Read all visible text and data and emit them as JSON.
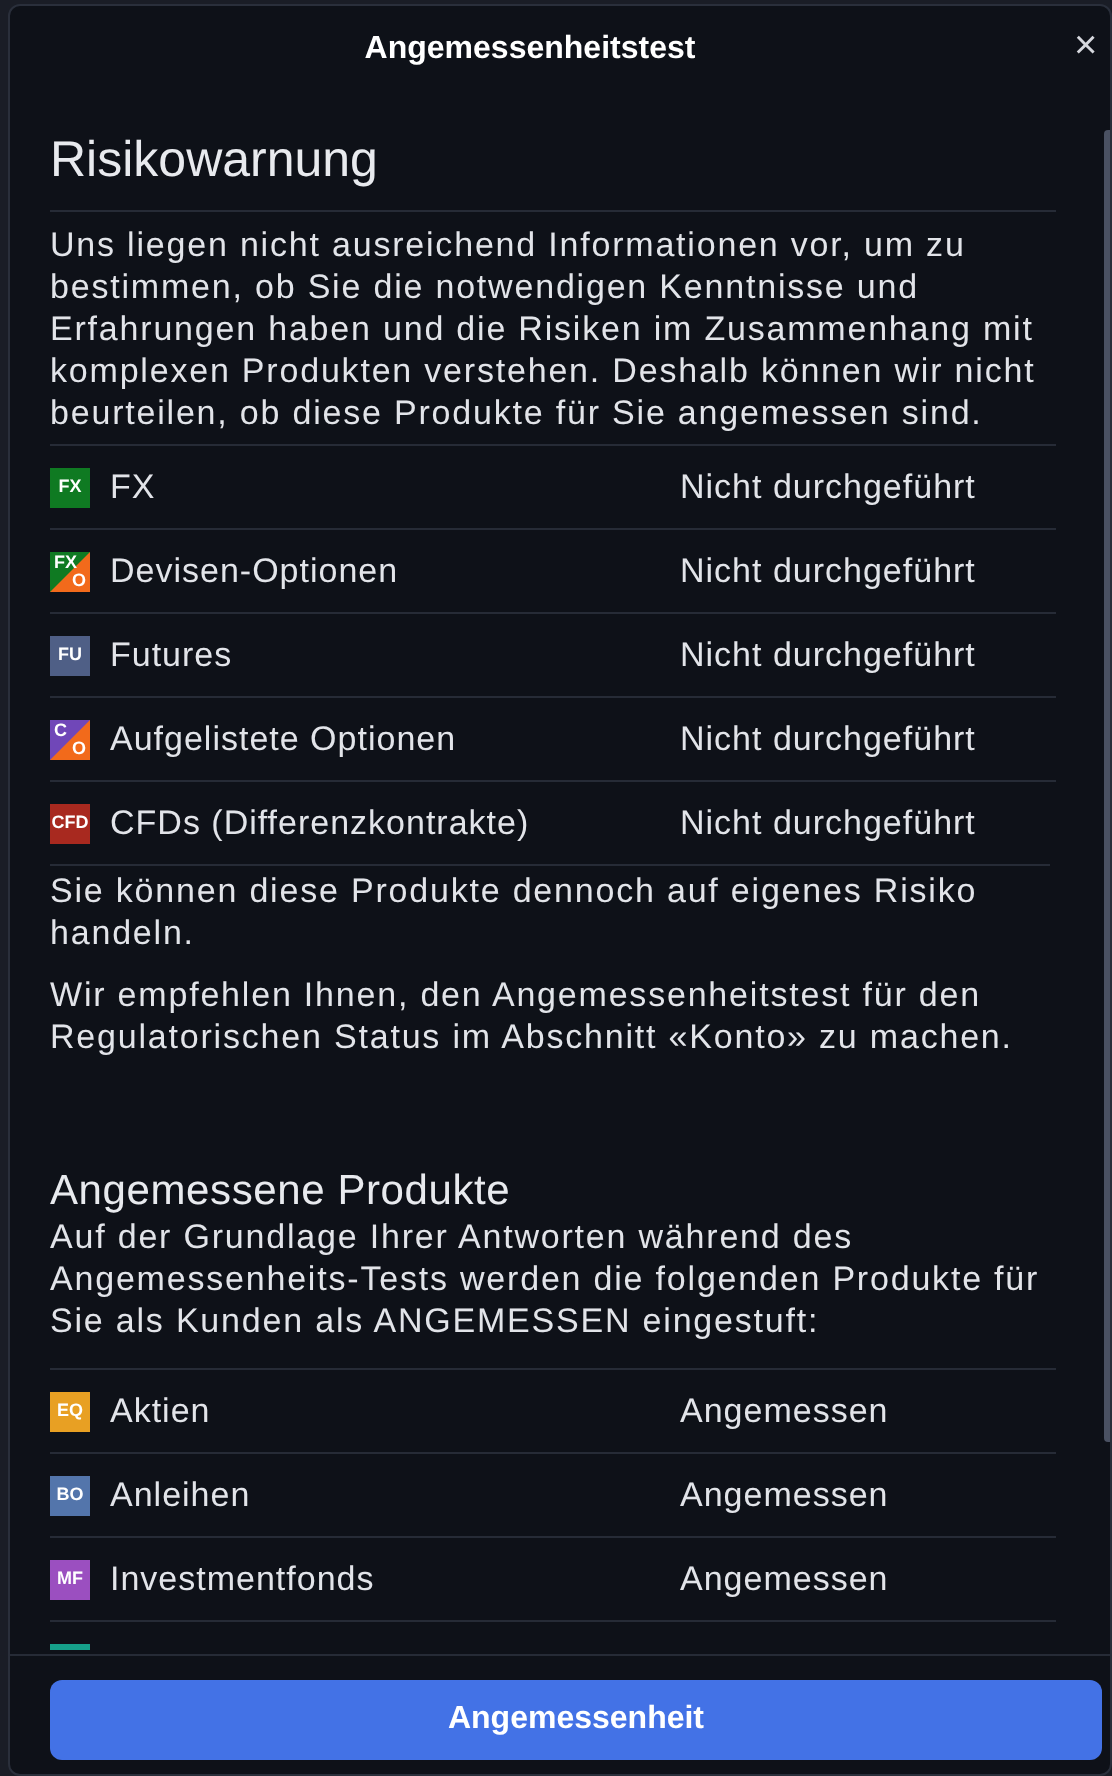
{
  "dialog": {
    "title": "Angemessenheitstest",
    "close": "×"
  },
  "warning": {
    "heading": "Risikowarnung",
    "text": "Uns liegen nicht ausreichend Informationen vor, um zu bestimmen, ob Sie die notwendigen Kenntnisse und Erfahrungen haben und die Risiken im Zusammenhang mit komplexen Produkten verstehen. Deshalb können wir nicht beurteilen, ob diese Produkte für Sie angemessen sind.",
    "rows": [
      {
        "kind": "plain",
        "badge": [
          {
            "text": "FX",
            "color": "#0f7a22"
          }
        ],
        "name": "FX",
        "status": "Nicht durchgeführt"
      },
      {
        "kind": "split",
        "badge": [
          {
            "text": "FX",
            "color": "#0f7a22"
          },
          {
            "text": "O",
            "color": "#f26a1b"
          }
        ],
        "name": "Devisen-Optionen",
        "status": "Nicht durchgeführt"
      },
      {
        "kind": "plain",
        "badge": [
          {
            "text": "FU",
            "color": "#4f5f86"
          }
        ],
        "name": "Futures",
        "status": "Nicht durchgeführt"
      },
      {
        "kind": "split",
        "badge": [
          {
            "text": "C",
            "color": "#7047b8"
          },
          {
            "text": "O",
            "color": "#f26a1b"
          }
        ],
        "name": "Aufgelistete Optionen",
        "status": "Nicht durchgeführt"
      },
      {
        "kind": "plain",
        "badge": [
          {
            "text": "CFD",
            "color": "#a8291f"
          }
        ],
        "name": "CFDs (Differenzkontrakte)",
        "status": "Nicht durchgeführt"
      }
    ],
    "notes": [
      "Sie können diese Produkte dennoch auf eigenes Risiko handeln.",
      "Wir empfehlen Ihnen, den Angemessenheitstest für den Regulatorischen Status im Abschnitt «Konto» zu machen."
    ]
  },
  "suitable": {
    "heading": "Angemessene Produkte",
    "text": "Auf der Grundlage Ihrer Antworten während des Angemessenheits-Tests werden die folgenden Produkte für Sie als Kunden als ANGEMESSEN eingestuft:",
    "rows": [
      {
        "kind": "plain",
        "badge": [
          {
            "text": "EQ",
            "color": "#e8a023"
          }
        ],
        "name": "Aktien",
        "status": "Angemessen"
      },
      {
        "kind": "plain",
        "badge": [
          {
            "text": "BO",
            "color": "#5375ab"
          }
        ],
        "name": "Anleihen",
        "status": "Angemessen"
      },
      {
        "kind": "plain",
        "badge": [
          {
            "text": "MF",
            "color": "#9b4fc0"
          }
        ],
        "name": "Investmentfonds",
        "status": "Angemessen"
      },
      {
        "kind": "clipped",
        "color": "#16a08a"
      }
    ]
  },
  "button": "Angemessenheit"
}
